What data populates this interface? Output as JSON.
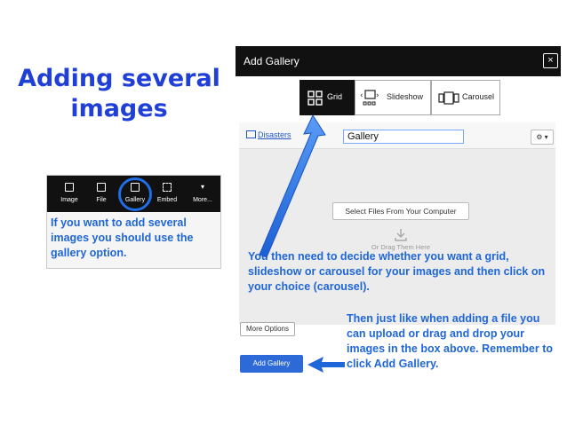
{
  "slide": {
    "title": "Adding several images"
  },
  "inset": {
    "toolbar": [
      {
        "label": "Image",
        "icon": "image-icon"
      },
      {
        "label": "File",
        "icon": "file-icon"
      },
      {
        "label": "Gallery",
        "icon": "gallery-icon"
      },
      {
        "label": "Embed",
        "icon": "embed-icon"
      },
      {
        "label": "More...",
        "icon": "more-icon"
      }
    ],
    "note": "If you want to add several images you should use the gallery option."
  },
  "dialog": {
    "title": "Add Gallery",
    "close_glyph": "×",
    "types": [
      {
        "label": "Grid",
        "icon": "grid-icon",
        "selected": true
      },
      {
        "label": "Slideshow",
        "icon": "slideshow-icon",
        "selected": false
      },
      {
        "label": "Carousel",
        "icon": "carousel-icon",
        "selected": false
      }
    ],
    "folder_link": "Disasters",
    "gallery_name": "Gallery",
    "settings_glyph": "⚙ ▾",
    "select_files": "Select Files From Your Computer",
    "drop_hint": "Or Drag Them Here",
    "more_options": "More Options",
    "add_gallery": "Add Gallery"
  },
  "annotations": {
    "choose": "You then need to decide whether you want a grid, slideshow or carousel for your images and then click on your choice (carousel).",
    "upload": "Then just like when adding a file you can upload or drag and drop your images in the box above. Remember to click Add Gallery."
  },
  "colors": {
    "title_blue": "#1f3fd6",
    "note_blue": "#1f66d8",
    "button_blue": "#2d6ad8",
    "header_black": "#111111"
  }
}
